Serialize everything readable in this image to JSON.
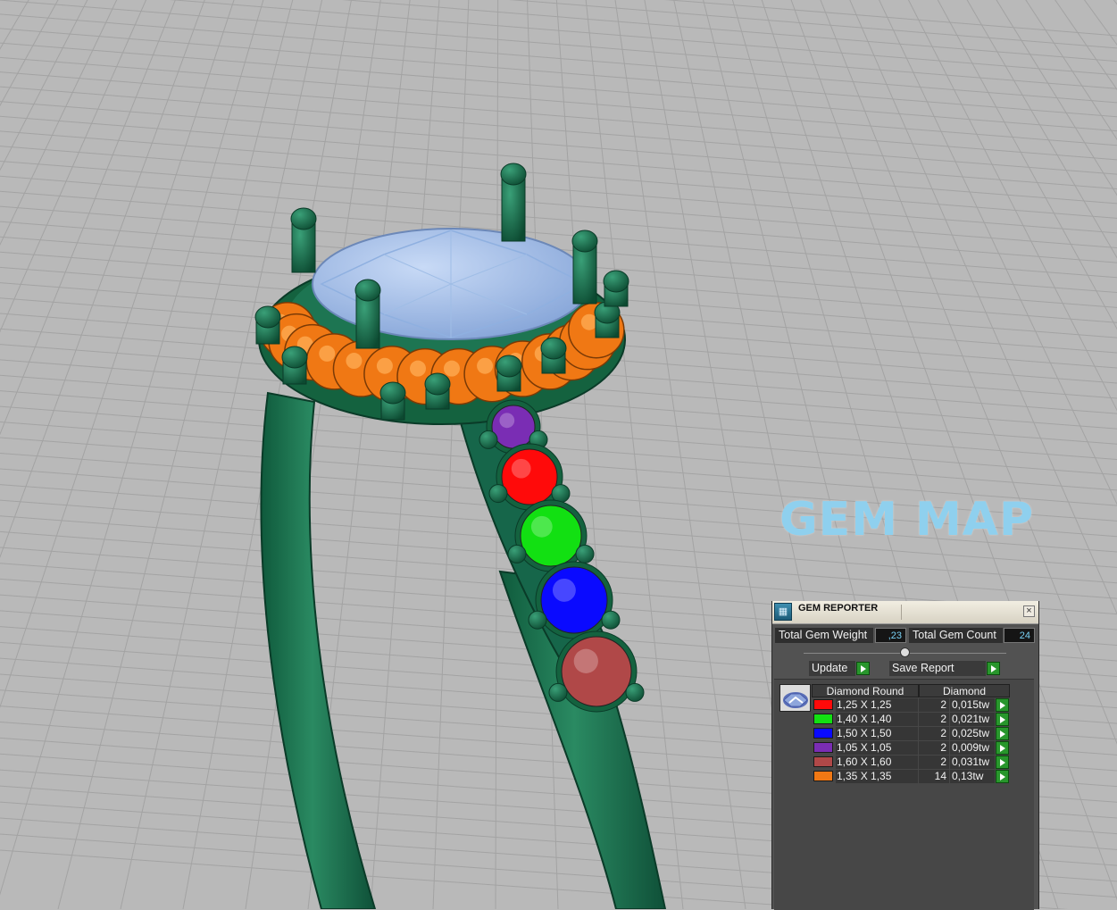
{
  "scene": {
    "overlay_title": "GEM MAP",
    "colors": {
      "background": "#b9b9b9",
      "grid": "#9a9a9a",
      "metal": "#1a6b4a",
      "center_stone": "#a9c4ee",
      "title": "#8fd0ee"
    }
  },
  "panel": {
    "title": "GEM REPORTER",
    "close_glyph": "×",
    "total_weight_label": "Total Gem Weight",
    "total_weight_value": ",23",
    "total_count_label": "Total Gem Count",
    "total_count_value": "24",
    "update_label": "Update",
    "save_report_label": "Save Report",
    "table": {
      "header_shape": "Diamond Round",
      "header_material": "Diamond",
      "rows": [
        {
          "color": "#ff0a0a",
          "size": "1,25 X 1,25",
          "count": "2",
          "weight": "0,015tw"
        },
        {
          "color": "#12e012",
          "size": "1,40 X 1,40",
          "count": "2",
          "weight": "0,021tw"
        },
        {
          "color": "#0a0aff",
          "size": "1,50 X 1,50",
          "count": "2",
          "weight": "0,025tw"
        },
        {
          "color": "#7a2db4",
          "size": "1,05 X 1,05",
          "count": "2",
          "weight": "0,009tw"
        },
        {
          "color": "#b04848",
          "size": "1,60 X 1,60",
          "count": "2",
          "weight": "0,031tw"
        },
        {
          "color": "#f07814",
          "size": "1,35 X 1,35",
          "count": "14",
          "weight": "0,13tw"
        }
      ]
    }
  }
}
